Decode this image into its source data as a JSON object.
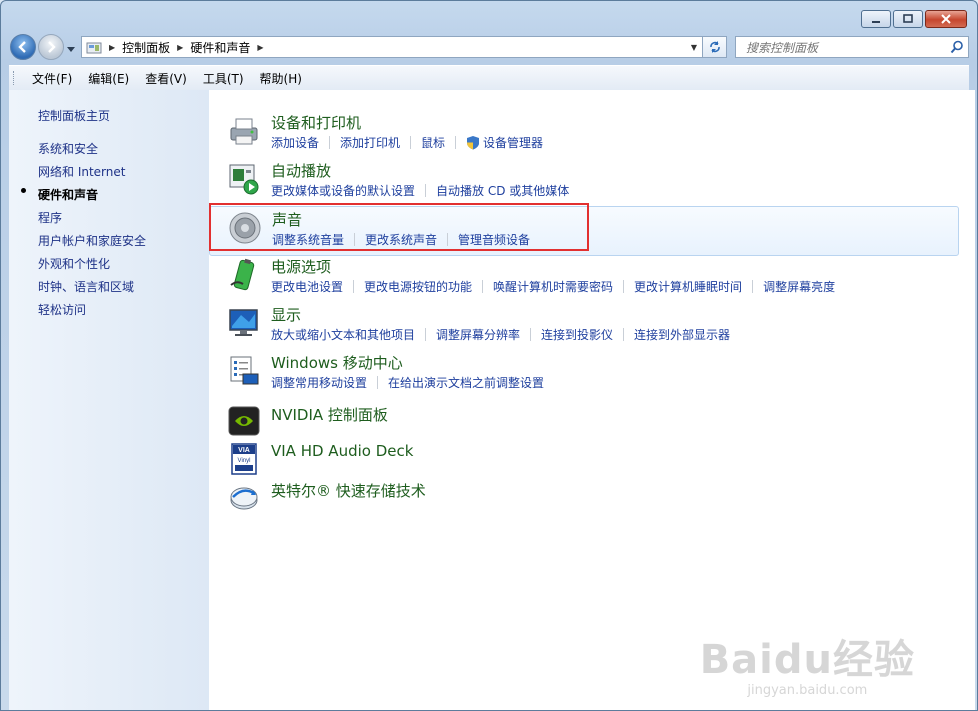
{
  "window": {
    "controls": [
      "minimize",
      "maximize",
      "close"
    ]
  },
  "address": {
    "segments": [
      "控制面板",
      "硬件和声音"
    ]
  },
  "search": {
    "placeholder": "搜索控制面板"
  },
  "menu": [
    "文件(F)",
    "编辑(E)",
    "查看(V)",
    "工具(T)",
    "帮助(H)"
  ],
  "sidebar": {
    "home": "控制面板主页",
    "items": [
      "系统和安全",
      "网络和 Internet",
      "硬件和声音",
      "程序",
      "用户帐户和家庭安全",
      "外观和个性化",
      "时钟、语言和区域",
      "轻松访问"
    ],
    "active_index": 2
  },
  "categories": [
    {
      "title": "设备和打印机",
      "icon": "printer-icon",
      "links": [
        "添加设备",
        "添加打印机",
        "鼠标",
        "设备管理器"
      ]
    },
    {
      "title": "自动播放",
      "icon": "autoplay-icon",
      "links": [
        "更改媒体或设备的默认设置",
        "自动播放 CD 或其他媒体"
      ]
    },
    {
      "title": "声音",
      "icon": "speaker-icon",
      "links": [
        "调整系统音量",
        "更改系统声音",
        "管理音频设备"
      ],
      "highlighted": true
    },
    {
      "title": "电源选项",
      "icon": "battery-icon",
      "links": [
        "更改电池设置",
        "更改电源按钮的功能",
        "唤醒计算机时需要密码",
        "更改计算机睡眠时间",
        "调整屏幕亮度"
      ]
    },
    {
      "title": "显示",
      "icon": "monitor-icon",
      "links": [
        "放大或缩小文本和其他项目",
        "调整屏幕分辨率",
        "连接到投影仪",
        "连接到外部显示器"
      ]
    },
    {
      "title": "Windows 移动中心",
      "icon": "mobility-center-icon",
      "links": [
        "调整常用移动设置",
        "在给出演示文档之前调整设置"
      ]
    },
    {
      "title": "NVIDIA 控制面板",
      "icon": "nvidia-icon",
      "links": []
    },
    {
      "title": "VIA HD Audio Deck",
      "icon": "via-audio-icon",
      "links": []
    },
    {
      "title": "英特尔® 快速存储技术",
      "icon": "intel-storage-icon",
      "links": []
    }
  ],
  "watermark": {
    "brand": "Baidu经验",
    "url": "jingyan.baidu.com"
  },
  "colors": {
    "link": "#1e3f9e",
    "title": "#1e5d1e",
    "sidebar_link": "#1e3287",
    "highlight_border": "#e23030"
  }
}
